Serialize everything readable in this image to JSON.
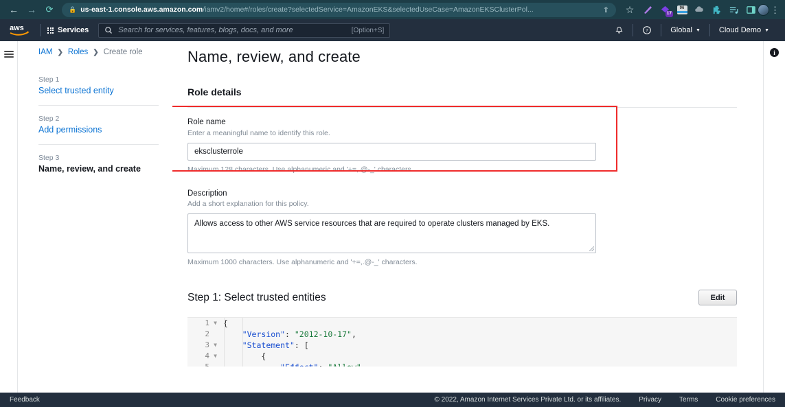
{
  "browser": {
    "back_icon": "back-arrow",
    "forward_icon": "forward-arrow",
    "reload_icon": "reload",
    "lock_icon": "lock",
    "url_bold": "us-east-1.console.aws.amazon.com",
    "url_rest": "/iamv2/home#/roles/create?selectedService=AmazonEKS&selectedUseCase=AmazonEKSClusterPol...",
    "share_icon": "share",
    "bookmark_icon": "star",
    "extensions": [
      {
        "name": "highlighter-pen-icon",
        "badge": ""
      },
      {
        "name": "purple-diamond-icon",
        "badge": "17"
      },
      {
        "name": "tile-counter-icon",
        "badge": "96"
      },
      {
        "name": "cloud-icon",
        "badge": ""
      },
      {
        "name": "puzzle-piece-icon",
        "badge": ""
      },
      {
        "name": "playlist-icon",
        "badge": ""
      },
      {
        "name": "side-panel-icon",
        "badge": ""
      }
    ],
    "avatar_name": "profile-avatar",
    "menu_icon": "kebab-menu"
  },
  "awsnav": {
    "logo_alt": "aws",
    "services_label": "Services",
    "search_placeholder": "Search for services, features, blogs, docs, and more",
    "search_shortcut": "[Option+S]",
    "search_icon": "search-icon",
    "bell_icon": "notifications-bell",
    "help_icon": "help-circle",
    "region_label": "Global",
    "account_label": "Cloud Demo",
    "caret": "▼"
  },
  "breadcrumb": {
    "items": [
      {
        "label": "IAM",
        "link": true
      },
      {
        "label": "Roles",
        "link": true
      },
      {
        "label": "Create role",
        "link": false
      }
    ],
    "separator": "❯"
  },
  "steps": [
    {
      "num": "Step 1",
      "name": "Select trusted entity",
      "active": false
    },
    {
      "num": "Step 2",
      "name": "Add permissions",
      "active": false
    },
    {
      "num": "Step 3",
      "name": "Name, review, and create",
      "active": true
    }
  ],
  "main": {
    "page_title": "Name, review, and create",
    "section_title": "Role details",
    "role_name": {
      "label": "Role name",
      "description": "Enter a meaningful name to identify this role.",
      "value": "eksclusterrole",
      "hint": "Maximum 128 characters. Use alphanumeric and '+=,.@-_' characters."
    },
    "description": {
      "label": "Description",
      "description": "Add a short explanation for this policy.",
      "value": "Allows access to other AWS service resources that are required to operate clusters managed by EKS.",
      "hint": "Maximum 1000 characters. Use alphanumeric and '+=,.@-_' characters."
    },
    "step1_section": {
      "heading": "Step 1: Select trusted entities",
      "edit_label": "Edit"
    },
    "trust_policy_code": [
      {
        "n": "1",
        "fold": true,
        "tokens": [
          {
            "t": "{",
            "c": "p"
          }
        ]
      },
      {
        "n": "2",
        "fold": false,
        "tokens": [
          {
            "t": "    ",
            "c": "p"
          },
          {
            "t": "\"Version\"",
            "c": "k"
          },
          {
            "t": ": ",
            "c": "p"
          },
          {
            "t": "\"2012-10-17\"",
            "c": "s"
          },
          {
            "t": ",",
            "c": "p"
          }
        ]
      },
      {
        "n": "3",
        "fold": true,
        "tokens": [
          {
            "t": "    ",
            "c": "p"
          },
          {
            "t": "\"Statement\"",
            "c": "k"
          },
          {
            "t": ": [",
            "c": "p"
          }
        ]
      },
      {
        "n": "4",
        "fold": true,
        "tokens": [
          {
            "t": "        {",
            "c": "p"
          }
        ]
      },
      {
        "n": "5",
        "fold": false,
        "tokens": [
          {
            "t": "            ",
            "c": "p"
          },
          {
            "t": "\"Effect\"",
            "c": "k"
          },
          {
            "t": ": ",
            "c": "p"
          },
          {
            "t": "\"Allow\"",
            "c": "s"
          }
        ]
      }
    ],
    "info_icon_label": "i"
  },
  "annotation": {
    "color": "#ef2b2b",
    "target": "role-name-field"
  },
  "footer": {
    "feedback": "Feedback",
    "copyright": "© 2022, Amazon Internet Services Private Ltd. or its affiliates.",
    "privacy": "Privacy",
    "terms": "Terms",
    "cookies": "Cookie preferences"
  }
}
